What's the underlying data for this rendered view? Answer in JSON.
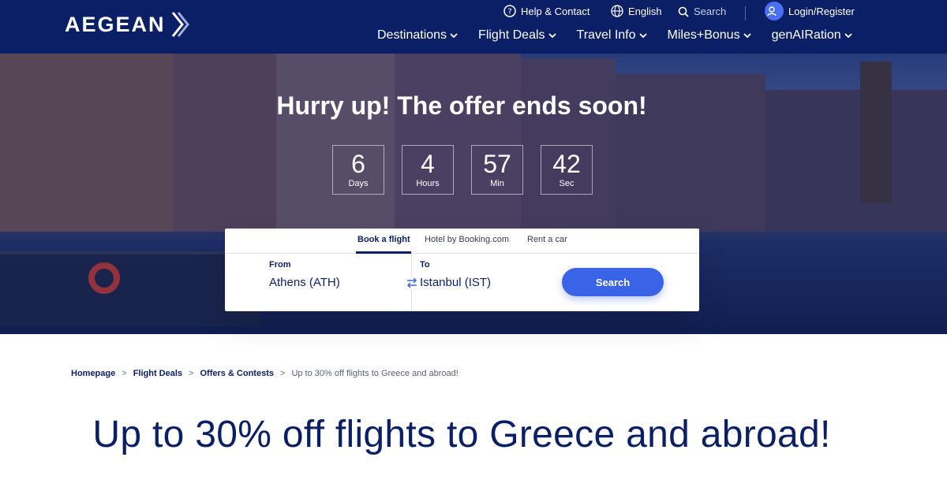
{
  "header": {
    "logo_text": "AEGEAN",
    "utility": {
      "help": "Help & Contact",
      "language": "English",
      "search_placeholder": "Search",
      "login": "Login/Register"
    },
    "nav": [
      {
        "label": "Destinations"
      },
      {
        "label": "Flight Deals"
      },
      {
        "label": "Travel Info"
      },
      {
        "label": "Miles+Bonus"
      },
      {
        "label": "genAIRation"
      }
    ]
  },
  "hero": {
    "title": "Hurry up! The offer ends soon!",
    "countdown": [
      {
        "value": "6",
        "label": "Days"
      },
      {
        "value": "4",
        "label": "Hours"
      },
      {
        "value": "57",
        "label": "Min"
      },
      {
        "value": "42",
        "label": "Sec"
      }
    ]
  },
  "booking": {
    "tabs": [
      "Book a flight",
      "Hotel by Booking.com",
      "Rent a car"
    ],
    "active_tab": "Book a flight",
    "from_label": "From",
    "from_value": "Athens (ATH)",
    "to_label": "To",
    "to_value": "Istanbul (IST)",
    "search_label": "Search"
  },
  "breadcrumb": {
    "items": [
      "Homepage",
      "Flight Deals",
      "Offers & Contests"
    ],
    "separator": ">",
    "current": "Up to 30% off flights to Greece and abroad!"
  },
  "page_title": "Up to 30% off flights to Greece and abroad!",
  "colors": {
    "brand_navy": "#0b1f66",
    "accent_blue": "#3a63e8",
    "avatar_blue": "#4a6ef5"
  }
}
